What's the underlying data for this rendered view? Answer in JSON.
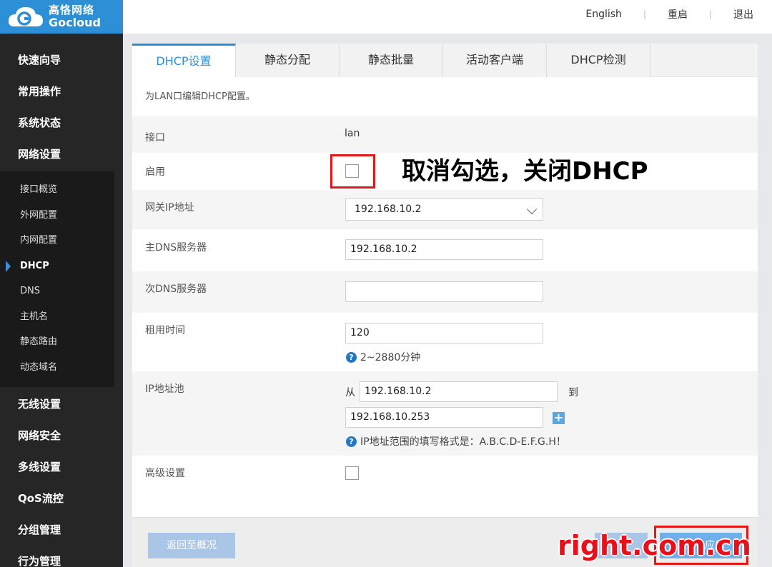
{
  "brand": {
    "name_cn": "高恪网络",
    "name_en": "Gocloud",
    "color": "#2d8fd5"
  },
  "header": {
    "links": [
      "English",
      "重启",
      "退出"
    ]
  },
  "sidebar": {
    "items_top": [
      "快速向导",
      "常用操作",
      "系统状态",
      "网络设置"
    ],
    "sub_items": [
      "接口概览",
      "外网配置",
      "内网配置",
      "DHCP",
      "DNS",
      "主机名",
      "静态路由",
      "动态域名"
    ],
    "active_sub": "DHCP",
    "items_bottom": [
      "无线设置",
      "网络安全",
      "多线设置",
      "QoS流控",
      "分组管理",
      "行为管理"
    ]
  },
  "tabs": [
    "DHCP设置",
    "静态分配",
    "静态批量",
    "活动客户端",
    "DHCP检测"
  ],
  "active_tab": "DHCP设置",
  "description": "为LAN口编辑DHCP配置。",
  "form": {
    "interface_label": "接口",
    "interface_value": "lan",
    "enable_label": "启用",
    "enable_checked": false,
    "gateway_label": "网关IP地址",
    "gateway_value": "192.168.10.2",
    "primary_dns_label": "主DNS服务器",
    "primary_dns_value": "192.168.10.2",
    "secondary_dns_label": "次DNS服务器",
    "secondary_dns_value": "",
    "lease_label": "租用时间",
    "lease_value": "120",
    "lease_hint": "2~2880分钟",
    "pool_label": "IP地址池",
    "pool_from_label": "从",
    "pool_from_value": "192.168.10.2",
    "pool_to_label": "到",
    "pool_to_value": "192.168.10.253",
    "pool_hint": "IP地址范围的填写格式是：A.B.C.D-E.F.G.H！",
    "advanced_label": "高级设置",
    "advanced_checked": false
  },
  "annotation": "取消勾选，关闭DHCP",
  "footer": {
    "back_label": "返回至概况",
    "mid_label": "",
    "save_label": "保存&应用"
  },
  "watermark": "right.com.cn",
  "colors": {
    "accent": "#2d8fd5",
    "highlight": "#e01818",
    "sidebar": "#262626"
  }
}
